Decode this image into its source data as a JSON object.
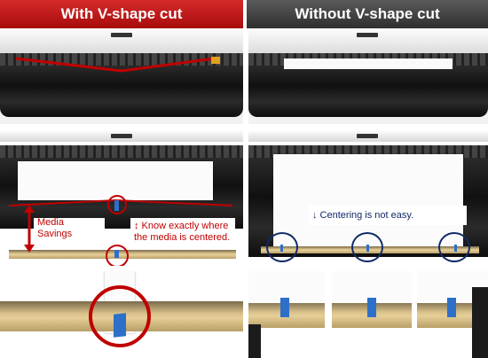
{
  "headers": {
    "left_title": "With V-shape cut",
    "right_title": "Without V-shape cut"
  },
  "callouts": {
    "media_savings": "Media Savings",
    "know_centered": "↕ Know exactly where the media is centered.",
    "centering_not_easy": "↓ Centering is not easy."
  },
  "colors": {
    "brand_red": "#c00000",
    "header_gray": "#3f3f3f",
    "navy": "#122a66",
    "tab_blue": "#2e6fc9"
  },
  "icons": {
    "vertical_arrow": "double-arrow-vertical-icon",
    "down_arrow": "arrow-down-icon"
  }
}
